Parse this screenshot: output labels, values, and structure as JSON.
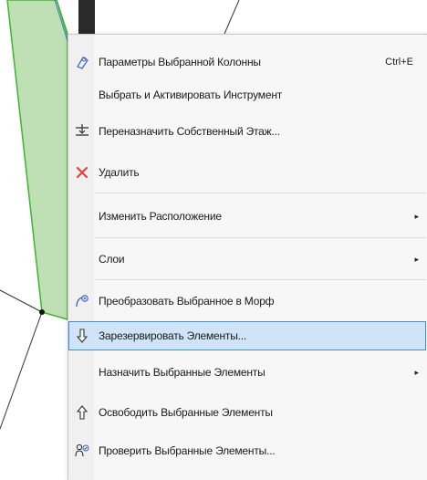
{
  "context_menu": {
    "items": [
      {
        "label": "Параметры Выбранной Колонны",
        "shortcut": "Ctrl+E",
        "icon": "column-settings-icon"
      },
      {
        "label": "Выбрать и Активировать Инструмент"
      },
      {
        "label": "Переназначить Собственный Этаж...",
        "icon": "story-reassign-icon"
      },
      {
        "label": "Удалить",
        "icon": "delete-x-icon"
      },
      {
        "label": "Изменить Расположение",
        "submenu": true
      },
      {
        "label": "Слои",
        "submenu": true
      },
      {
        "label": "Преобразовать Выбранное в Морф",
        "icon": "morph-convert-icon"
      },
      {
        "label": "Зарезервировать Элементы...",
        "icon": "reserve-arrow-down-icon",
        "highlighted": true
      },
      {
        "label": "Назначить Выбранные Элементы",
        "submenu": true
      },
      {
        "label": "Освободить Выбранные Элементы",
        "icon": "release-arrow-up-icon"
      },
      {
        "label": "Проверить Выбранные Элементы...",
        "icon": "check-elements-icon"
      }
    ],
    "submenu_glyph": "▸",
    "colors": {
      "highlight_bg": "#cfe5f7",
      "highlight_border": "#3c8fd2",
      "delete_icon": "#e0443a",
      "column_fill": "#b9dcb0",
      "column_edge": "#38b52a"
    }
  }
}
